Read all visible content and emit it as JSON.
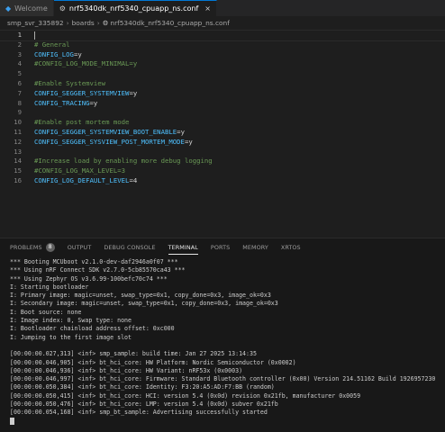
{
  "tabs": [
    {
      "label": "Welcome",
      "icon": "vscode-icon",
      "active": false
    },
    {
      "label": "nrf5340dk_nrf5340_cpuapp_ns.conf",
      "icon": "gear-icon",
      "active": true
    }
  ],
  "tab_close_glyph": "×",
  "breadcrumb": {
    "parts": [
      "smp_svr_335892",
      "boards",
      "nrf5340dk_nrf5340_cpuapp_ns.conf"
    ],
    "separator": "›"
  },
  "editor": {
    "lines": [
      {
        "n": "1",
        "tokens": []
      },
      {
        "n": "2",
        "tokens": [
          {
            "t": "# General",
            "c": "cmt"
          }
        ]
      },
      {
        "n": "3",
        "tokens": [
          {
            "t": "CONFIG_LOG",
            "c": "key"
          },
          {
            "t": "=",
            "c": "op"
          },
          {
            "t": "y",
            "c": "val"
          }
        ]
      },
      {
        "n": "4",
        "tokens": [
          {
            "t": "#CONFIG_LOG_MODE_MINIMAL=y",
            "c": "cmt"
          }
        ]
      },
      {
        "n": "5",
        "tokens": []
      },
      {
        "n": "6",
        "tokens": [
          {
            "t": "#Enable Systemview",
            "c": "cmt"
          }
        ]
      },
      {
        "n": "7",
        "tokens": [
          {
            "t": "CONFIG_SEGGER_SYSTEMVIEW",
            "c": "key"
          },
          {
            "t": "=",
            "c": "op"
          },
          {
            "t": "y",
            "c": "val"
          }
        ]
      },
      {
        "n": "8",
        "tokens": [
          {
            "t": "CONFIG_TRACING",
            "c": "key"
          },
          {
            "t": "=",
            "c": "op"
          },
          {
            "t": "y",
            "c": "val"
          }
        ]
      },
      {
        "n": "9",
        "tokens": []
      },
      {
        "n": "10",
        "tokens": [
          {
            "t": "#Enable post mortem mode",
            "c": "cmt"
          }
        ]
      },
      {
        "n": "11",
        "tokens": [
          {
            "t": "CONFIG_SEGGER_SYSTEMVIEW_BOOT_ENABLE",
            "c": "key"
          },
          {
            "t": "=",
            "c": "op"
          },
          {
            "t": "y",
            "c": "val"
          }
        ]
      },
      {
        "n": "12",
        "tokens": [
          {
            "t": "CONFIG_SEGGER_SYSVIEW_POST_MORTEM_MODE",
            "c": "key"
          },
          {
            "t": "=",
            "c": "op"
          },
          {
            "t": "y",
            "c": "val"
          }
        ]
      },
      {
        "n": "13",
        "tokens": []
      },
      {
        "n": "14",
        "tokens": [
          {
            "t": "#Increase load by enabling more debug logging",
            "c": "cmt"
          }
        ]
      },
      {
        "n": "15",
        "tokens": [
          {
            "t": "#CONFIG_LOG_MAX_LEVEL=3",
            "c": "cmt"
          }
        ]
      },
      {
        "n": "16",
        "tokens": [
          {
            "t": "CONFIG_LOG_DEFAULT_LEVEL",
            "c": "key"
          },
          {
            "t": "=",
            "c": "op"
          },
          {
            "t": "4",
            "c": "val"
          }
        ]
      }
    ]
  },
  "panel": {
    "tabs": [
      {
        "label": "PROBLEMS",
        "badge": "8",
        "active": false
      },
      {
        "label": "OUTPUT",
        "active": false
      },
      {
        "label": "DEBUG CONSOLE",
        "active": false
      },
      {
        "label": "TERMINAL",
        "active": true
      },
      {
        "label": "PORTS",
        "active": false
      },
      {
        "label": "MEMORY",
        "active": false
      },
      {
        "label": "XRTOS",
        "active": false
      }
    ],
    "terminal_lines": [
      "*** Booting MCUboot v2.1.0-dev-daf2946a0f07 ***",
      "*** Using nRF Connect SDK v2.7.0-5cb85570ca43 ***",
      "*** Using Zephyr OS v3.6.99-100befc70c74 ***",
      "I: Starting bootloader",
      "I: Primary image: magic=unset, swap_type=0x1, copy_done=0x3, image_ok=0x3",
      "I: Secondary image: magic=unset, swap_type=0x1, copy_done=0x3, image_ok=0x3",
      "I: Boot source: none",
      "I: Image index: 0, Swap type: none",
      "I: Bootloader chainload address offset: 0xc000",
      "I: Jumping to the first image slot",
      "",
      "[00:00:00.027,313] <inf> smp_sample: build time: Jan 27 2025 13:14:35",
      "[00:00:00.046,905] <inf> bt_hci_core: HW Platform: Nordic Semiconductor (0x0002)",
      "[00:00:00.046,936] <inf> bt_hci_core: HW Variant: nRF53x (0x0003)",
      "[00:00:00.046,997] <inf> bt_hci_core: Firmware: Standard Bluetooth controller (0x00) Version 214.51162 Build 1926957230",
      "[00:00:00.050,384] <inf> bt_hci_core: Identity: F3:20:A5:AD:F7:BB (random)",
      "[00:00:00.050,415] <inf> bt_hci_core: HCI: version 5.4 (0x0d) revision 0x21fb, manufacturer 0x0059",
      "[00:00:00.050,476] <inf> bt_hci_core: LMP: version 5.4 (0x0d) subver 0x21fb",
      "[00:00:00.054,168] <inf> smp_bt_sample: Advertising successfully started"
    ]
  }
}
